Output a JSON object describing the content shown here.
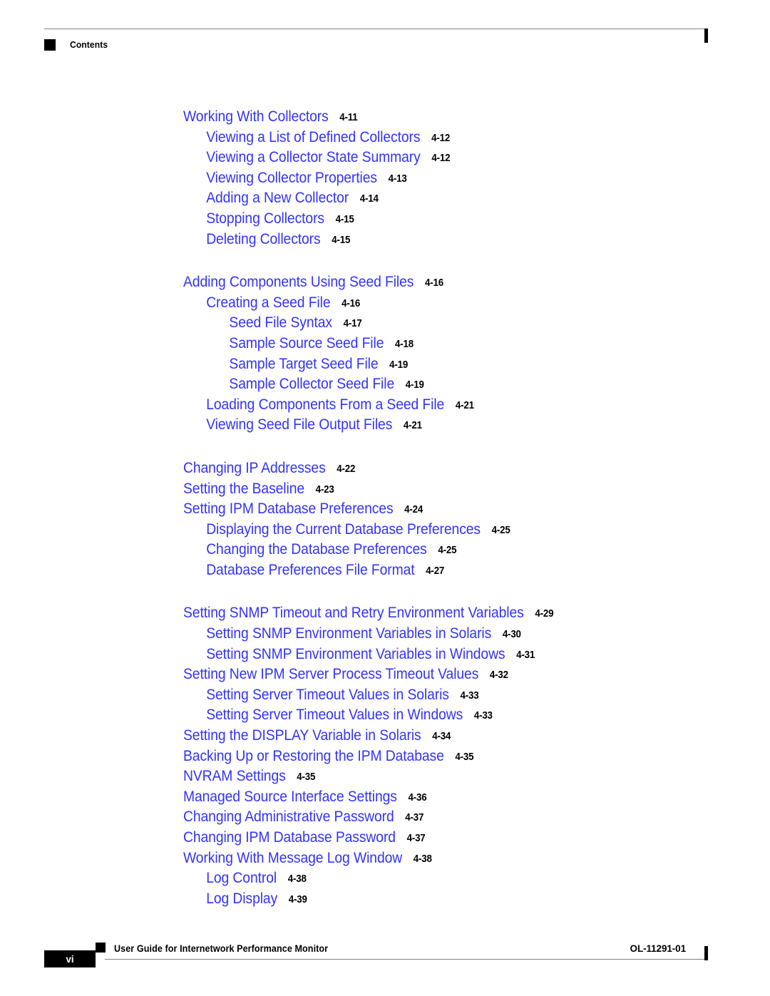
{
  "header": {
    "title": "Contents",
    "marker_icon": "black-square-icon"
  },
  "footer": {
    "page_number": "vi",
    "document_title": "User Guide for Internetwork Performance Monitor",
    "document_id": "OL-11291-01",
    "marker_icon": "black-square-icon"
  },
  "colors": {
    "link_blue": "#3333ff",
    "text_black": "#000000",
    "rule_gray": "#808080"
  },
  "toc": {
    "entries": [
      {
        "level": 1,
        "new_group": false,
        "title": "Working With Collectors",
        "page": "4-11"
      },
      {
        "level": 2,
        "new_group": false,
        "title": "Viewing a List of Defined Collectors",
        "page": "4-12"
      },
      {
        "level": 2,
        "new_group": false,
        "title": "Viewing a Collector State Summary",
        "page": "4-12"
      },
      {
        "level": 2,
        "new_group": false,
        "title": "Viewing Collector Properties",
        "page": "4-13"
      },
      {
        "level": 2,
        "new_group": false,
        "title": "Adding a New Collector",
        "page": "4-14"
      },
      {
        "level": 2,
        "new_group": false,
        "title": "Stopping Collectors",
        "page": "4-15"
      },
      {
        "level": 2,
        "new_group": false,
        "title": "Deleting Collectors",
        "page": "4-15"
      },
      {
        "level": 1,
        "new_group": true,
        "title": "Adding Components Using Seed Files",
        "page": "4-16"
      },
      {
        "level": 2,
        "new_group": false,
        "title": "Creating a Seed File",
        "page": "4-16"
      },
      {
        "level": 3,
        "new_group": false,
        "title": "Seed File Syntax",
        "page": "4-17"
      },
      {
        "level": 3,
        "new_group": false,
        "title": "Sample Source Seed File",
        "page": "4-18"
      },
      {
        "level": 3,
        "new_group": false,
        "title": "Sample Target Seed File",
        "page": "4-19"
      },
      {
        "level": 3,
        "new_group": false,
        "title": "Sample Collector Seed File",
        "page": "4-19"
      },
      {
        "level": 2,
        "new_group": false,
        "title": "Loading Components From a Seed File",
        "page": "4-21"
      },
      {
        "level": 2,
        "new_group": false,
        "title": "Viewing Seed File Output Files",
        "page": "4-21"
      },
      {
        "level": 1,
        "new_group": true,
        "title": "Changing IP Addresses",
        "page": "4-22"
      },
      {
        "level": 1,
        "new_group": false,
        "title": "Setting the Baseline",
        "page": "4-23"
      },
      {
        "level": 1,
        "new_group": false,
        "title": "Setting IPM Database Preferences",
        "page": "4-24"
      },
      {
        "level": 2,
        "new_group": false,
        "title": "Displaying the Current Database Preferences",
        "page": "4-25"
      },
      {
        "level": 2,
        "new_group": false,
        "title": "Changing the Database Preferences",
        "page": "4-25"
      },
      {
        "level": 2,
        "new_group": false,
        "title": "Database Preferences File Format",
        "page": "4-27"
      },
      {
        "level": 1,
        "new_group": true,
        "title": "Setting SNMP Timeout and Retry Environment Variables",
        "page": "4-29"
      },
      {
        "level": 2,
        "new_group": false,
        "title": "Setting SNMP Environment Variables in Solaris",
        "page": "4-30"
      },
      {
        "level": 2,
        "new_group": false,
        "title": "Setting SNMP Environment Variables in Windows",
        "page": "4-31"
      },
      {
        "level": 1,
        "new_group": false,
        "title": "Setting New IPM Server Process Timeout Values",
        "page": "4-32"
      },
      {
        "level": 2,
        "new_group": false,
        "title": "Setting Server Timeout Values in Solaris",
        "page": "4-33"
      },
      {
        "level": 2,
        "new_group": false,
        "title": "Setting Server Timeout Values in Windows",
        "page": "4-33"
      },
      {
        "level": 1,
        "new_group": false,
        "title": "Setting the DISPLAY Variable in Solaris",
        "page": "4-34"
      },
      {
        "level": 1,
        "new_group": false,
        "title": "Backing Up or Restoring the IPM Database",
        "page": "4-35"
      },
      {
        "level": 1,
        "new_group": false,
        "title": "NVRAM Settings",
        "page": "4-35"
      },
      {
        "level": 1,
        "new_group": false,
        "title": "Managed Source Interface Settings",
        "page": "4-36"
      },
      {
        "level": 1,
        "new_group": false,
        "title": "Changing Administrative Password",
        "page": "4-37"
      },
      {
        "level": 1,
        "new_group": false,
        "title": "Changing IPM Database Password",
        "page": "4-37"
      },
      {
        "level": 1,
        "new_group": false,
        "title": "Working With Message Log Window",
        "page": "4-38"
      },
      {
        "level": 2,
        "new_group": false,
        "title": "Log Control",
        "page": "4-38"
      },
      {
        "level": 2,
        "new_group": false,
        "title": "Log Display",
        "page": "4-39"
      }
    ]
  }
}
